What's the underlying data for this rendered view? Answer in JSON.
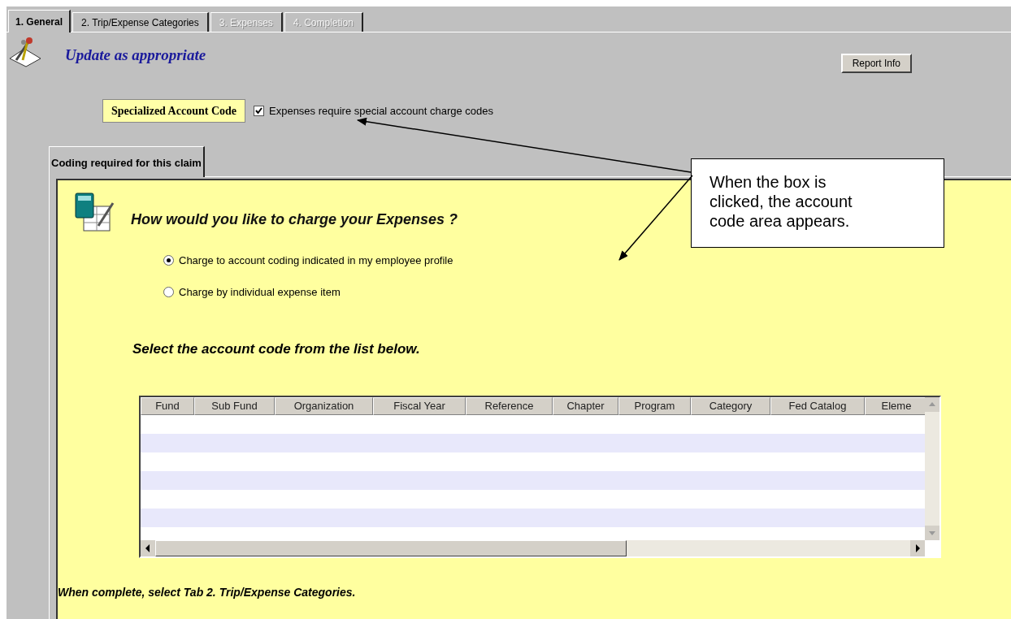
{
  "tabs": [
    {
      "label": "1. General",
      "selected": true,
      "disabled": false
    },
    {
      "label": "2. Trip/Expense Categories",
      "selected": false,
      "disabled": false
    },
    {
      "label": "3. Expenses",
      "selected": false,
      "disabled": true
    },
    {
      "label": "4. Completion",
      "selected": false,
      "disabled": true
    }
  ],
  "header": {
    "title": "Update as appropriate",
    "report_button": "Report Info"
  },
  "special_code": {
    "label": "Specialized Account Code",
    "checkbox_label": "Expenses require special account charge codes",
    "checked": true
  },
  "coding_tab": {
    "label": "Coding required for this claim",
    "selected": true
  },
  "question": "How would you like to charge your Expenses ?",
  "options": [
    {
      "label": "Charge to account coding indicated in my employee profile",
      "selected": true
    },
    {
      "label": "Charge by individual expense item",
      "selected": false
    }
  ],
  "list_heading": "Select the account code from the list below.",
  "table": {
    "columns": [
      "Fund",
      "Sub Fund",
      "Organization",
      "Fiscal Year",
      "Reference",
      "Chapter",
      "Program",
      "Category",
      "Fed Catalog",
      "Eleme"
    ]
  },
  "footer": "When complete, select Tab 2. Trip/Expense Categories.",
  "callout": "When the box is clicked, the account code area appears."
}
